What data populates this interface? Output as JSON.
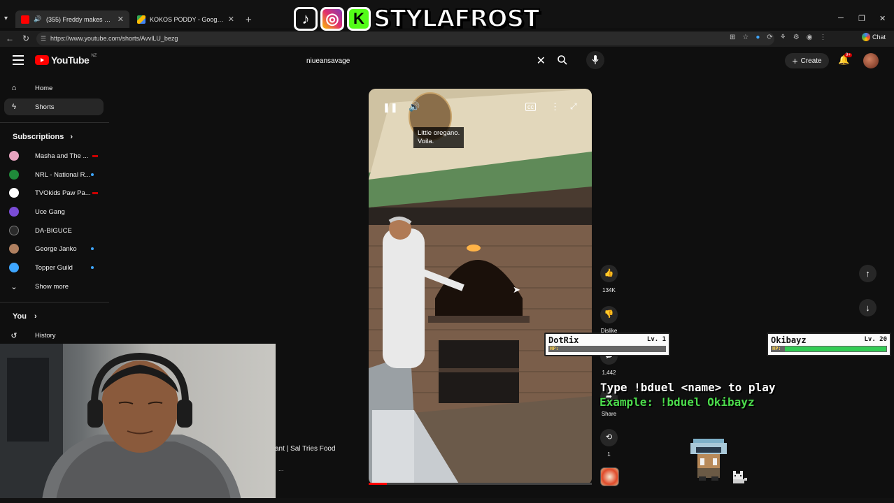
{
  "browser": {
    "tabs": [
      {
        "title": "(355) Freddy makes a PERFEC",
        "active": true
      },
      {
        "title": "KOKOS PODDY - Google Drive",
        "active": false
      }
    ],
    "url": "https://www.youtube.com/shorts/AvvlLU_bezg",
    "chat_label": "Chat"
  },
  "overlay_logo": {
    "letter": "K",
    "name": "STYLAFROST"
  },
  "header": {
    "logo": "YouTube",
    "country": "NZ",
    "search_value": "niueansavage",
    "create_label": "Create",
    "notif_badge": "9+"
  },
  "sidebar": {
    "nav": [
      {
        "label": "Home",
        "icon": "home-icon"
      },
      {
        "label": "Shorts",
        "icon": "shorts-icon",
        "active": true
      }
    ],
    "subscriptions_heading": "Subscriptions",
    "subscriptions": [
      {
        "label": "Masha and The ...",
        "indicator": "live",
        "color": "#e8a4c0"
      },
      {
        "label": "NRL - National R...",
        "indicator": "new",
        "color": "#1f8a3a"
      },
      {
        "label": "TVOkids Paw Pa...",
        "indicator": "live",
        "color": "#ffffff"
      },
      {
        "label": "Uce Gang",
        "indicator": "none",
        "color": "#7a4cd6"
      },
      {
        "label": "DA-BIGUCE",
        "indicator": "none",
        "color": "#2a2a2a"
      },
      {
        "label": "George Janko",
        "indicator": "new",
        "color": "#b08060"
      },
      {
        "label": "Topper Guild",
        "indicator": "new",
        "color": "#3ea6ff"
      }
    ],
    "show_more": "Show more",
    "you_heading": "You",
    "history": "History"
  },
  "video": {
    "caption_line1": "Little oregano.",
    "caption_line2": "Voila.",
    "progress": 0.08,
    "behind_title": "ant | Sal Tries Food",
    "behind_more": "..."
  },
  "actions": {
    "likes": "134K",
    "dislike": "Dislike",
    "comments": "1,442",
    "share": "Share",
    "remix": "1"
  },
  "game": {
    "player1": {
      "name": "DotRix",
      "level": "Lv. 1",
      "hp_label": "HP:",
      "hp": 0
    },
    "player2": {
      "name": "Okibayz",
      "level": "Lv. 20",
      "hp_label": "HP:",
      "hp": 1.0
    },
    "line1": "Type !bduel <name> to play",
    "line2": "Example: !bduel Okibayz"
  }
}
